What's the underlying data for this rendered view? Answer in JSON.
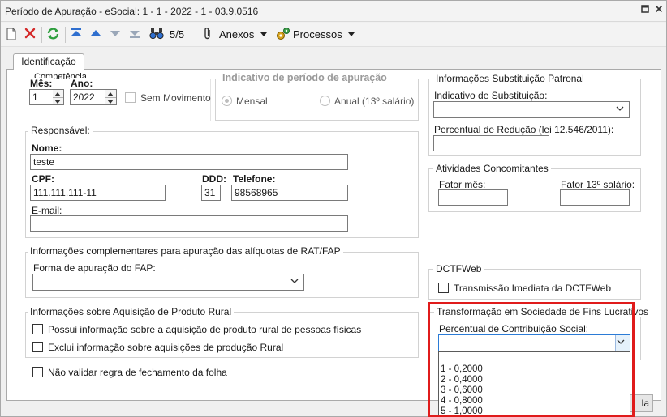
{
  "window": {
    "title": "Período de Apuração - eSocial: 1 - 1 - 2022 - 1 - 03.9.0516",
    "controls": [
      "restore-icon",
      "close-icon"
    ]
  },
  "toolbar": {
    "record_position": "5/5",
    "attachments_label": "Anexos",
    "processes_label": "Processos",
    "icons": [
      "new-document-icon",
      "delete-icon",
      "refresh-icon",
      "first-record-icon",
      "previous-record-icon",
      "next-record-icon",
      "last-record-icon",
      "binoculars-icon",
      "paperclip-icon",
      "gears-icon"
    ]
  },
  "tabs": [
    {
      "label": "Identificação",
      "active": true
    }
  ],
  "competencia": {
    "legend": "Competência",
    "month_label": "Mês:",
    "month_value": "1",
    "year_label": "Ano:",
    "year_value": "2022",
    "no_movement_label": "Sem Movimento",
    "no_movement_checked": false
  },
  "indicativo_periodo": {
    "legend": "Indicativo de período de apuração",
    "monthly_label": "Mensal",
    "monthly_checked": true,
    "annual_label": "Anual (13º salário)",
    "annual_checked": false
  },
  "responsavel": {
    "legend": "Responsável:",
    "name_label": "Nome:",
    "name_value": "teste",
    "cpf_label": "CPF:",
    "cpf_value": "111.111.111-11",
    "ddd_label": "DDD:",
    "ddd_value": "31",
    "phone_label": "Telefone:",
    "phone_value": "98568965",
    "email_label": "E-mail:",
    "email_value": ""
  },
  "rat_fap": {
    "legend": "Informações complementares para apuração das alíquotas de RAT/FAP",
    "form_label": "Forma de apuração do FAP:",
    "form_value": ""
  },
  "produto_rural": {
    "legend": "Informações sobre Aquisição de Produto Rural",
    "option1_label": "Possui informação sobre a aquisição de produto rural de pessoas físicas",
    "option1_checked": false,
    "option2_label": "Exclui informação sobre aquisições de produção Rural",
    "option2_checked": false
  },
  "fechamento": {
    "label": "Não validar regra de fechamento da folha",
    "checked": false
  },
  "substituicao_patronal": {
    "legend": "Informações Substituição Patronal",
    "indicator_label": "Indicativo de Substituição:",
    "indicator_value": "",
    "percent_label": "Percentual de Redução  (lei 12.546/2011):",
    "percent_value": ""
  },
  "atividades_concomitantes": {
    "legend": "Atividades Concomitantes",
    "factor_month_label": "Fator mês:",
    "factor_month_value": "",
    "factor_13_label": "Fator 13º salário:",
    "factor_13_value": ""
  },
  "dctfweb": {
    "legend": "DCTFWeb",
    "immediate_label": "Transmissão Imediata da DCTFWeb",
    "immediate_checked": false
  },
  "transformacao": {
    "legend": "Transformação em Sociedade de Fins Lucrativos",
    "percent_label": "Percentual de Contribuição Social:",
    "percent_value": "",
    "options": [
      "1 - 0,2000",
      "2 - 0,4000",
      "3 - 0,6000",
      "4 - 0,8000",
      "5 - 1,0000"
    ]
  },
  "footer": {
    "partial_button_label": "la"
  },
  "colors": {
    "highlight": "#e01b1b",
    "focus": "#2b7bd6",
    "delete": "#d42a2a",
    "refresh": "#2e9e3e",
    "nav": "#2f6fcf"
  }
}
